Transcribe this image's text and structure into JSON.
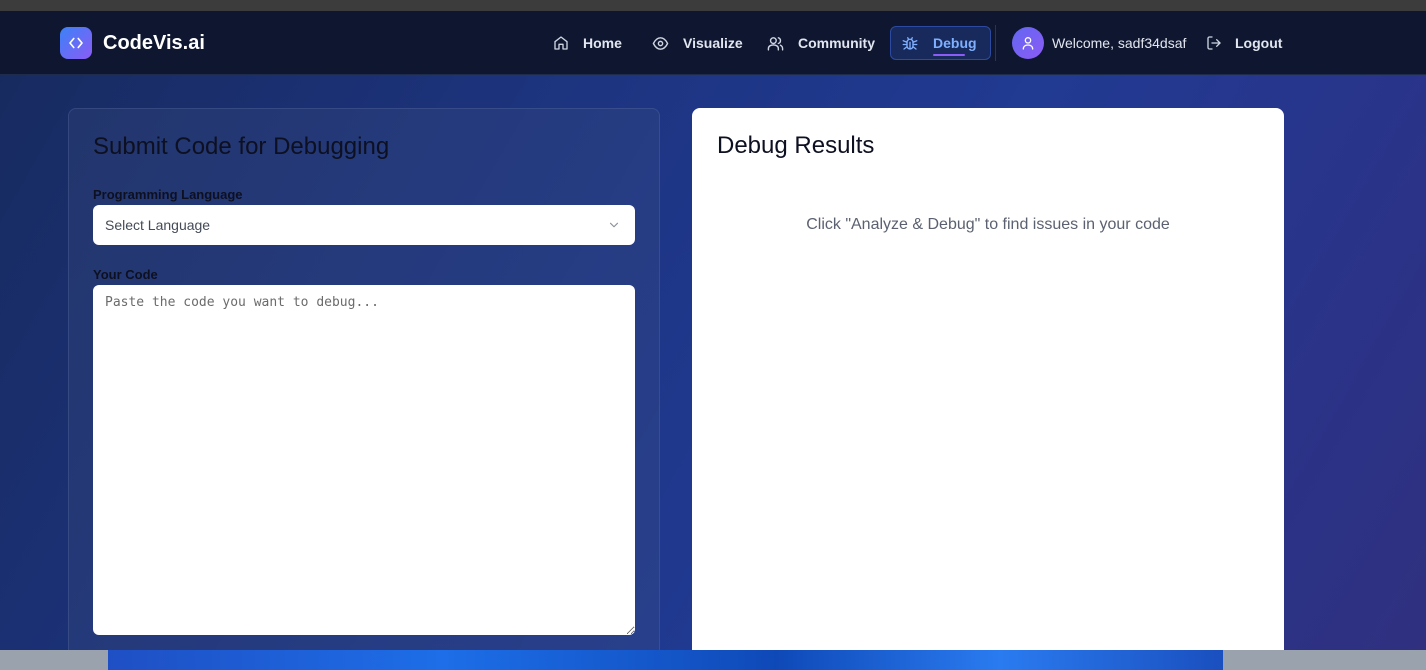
{
  "brand": {
    "name": "CodeVis.ai"
  },
  "nav": {
    "home": "Home",
    "visualize": "Visualize",
    "community": "Community",
    "debug": "Debug",
    "welcome": "Welcome, sadf34dsaf",
    "logout": "Logout",
    "active": "Debug"
  },
  "submit": {
    "title": "Submit Code for Debugging",
    "language_label": "Programming Language",
    "language_value": "Select Language",
    "code_label": "Your Code",
    "code_placeholder": "Paste the code you want to debug..."
  },
  "results": {
    "title": "Debug Results",
    "empty_message": "Click \"Analyze & Debug\" to find issues in your code"
  },
  "colors": {
    "accent": "#7fb0ff",
    "brand_gradient_start": "#3b82f6",
    "brand_gradient_end": "#8b5cf6",
    "navbar": "#0f1730"
  },
  "icons": [
    "code-icon",
    "home-icon",
    "eye-icon",
    "users-icon",
    "bug-icon",
    "user-icon",
    "logout-icon",
    "chevron-down-icon"
  ]
}
